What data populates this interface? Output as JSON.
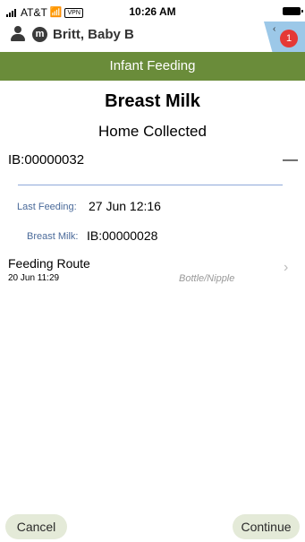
{
  "status_bar": {
    "carrier": "AT&T",
    "vpn": "VPN",
    "time": "10:26 AM"
  },
  "patient": {
    "initial": "m",
    "name": "Britt, Baby B",
    "notification_count": "1"
  },
  "screen_title": "Infant Feeding",
  "milk": {
    "type": "Breast Milk",
    "source": "Home Collected",
    "id": "IB:00000032",
    "collapse_symbol": "—"
  },
  "last_feeding": {
    "label": "Last Feeding:",
    "value": "27 Jun 12:16"
  },
  "breast_milk": {
    "label": "Breast Milk:",
    "value": "IB:00000028"
  },
  "feeding_route": {
    "title": "Feeding Route",
    "time": "20 Jun 11:29",
    "value": "Bottle/Nipple"
  },
  "footer": {
    "cancel": "Cancel",
    "continue": "Continue"
  }
}
